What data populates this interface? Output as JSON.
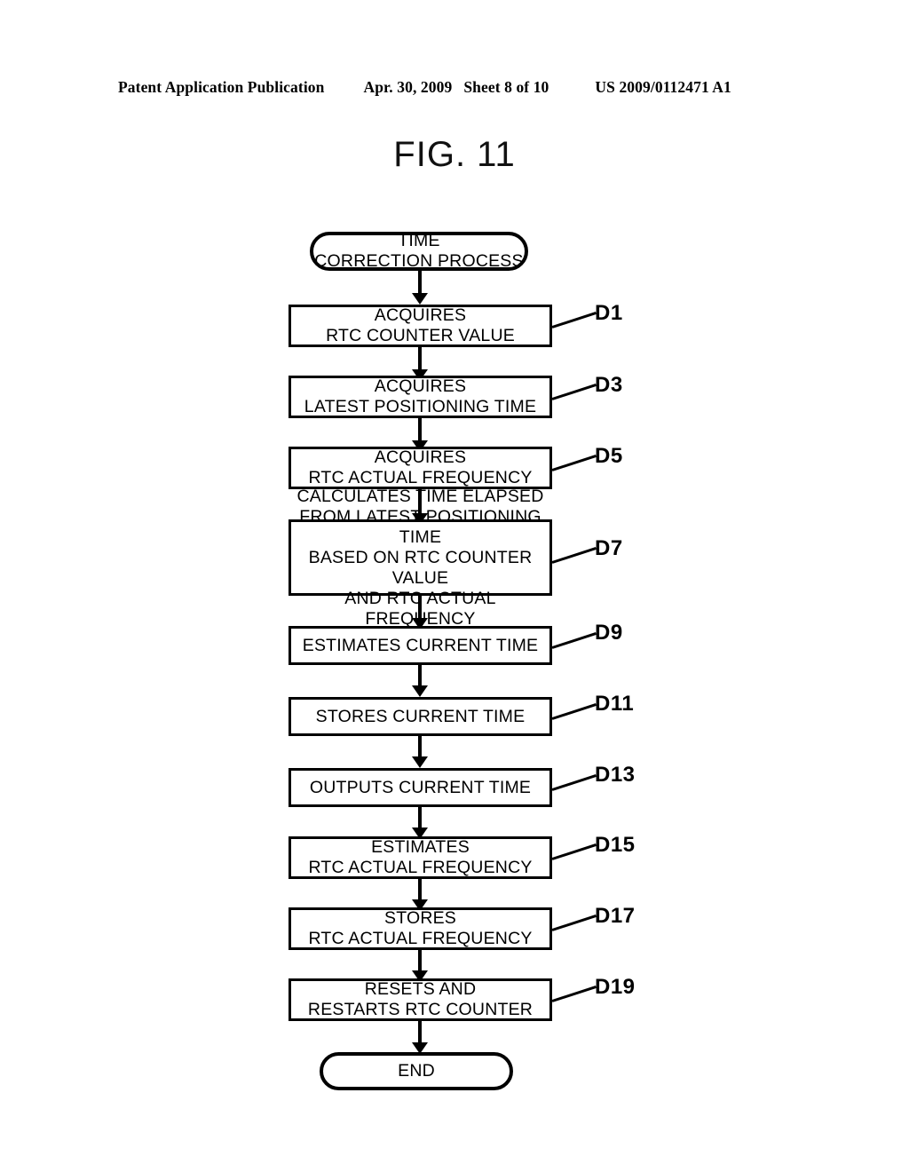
{
  "page_header": {
    "publication": "Patent Application Publication",
    "date": "Apr. 30, 2009",
    "sheet": "Sheet 8 of 10",
    "patent_number": "US 2009/0112471 A1"
  },
  "figure": {
    "title": "FIG. 11"
  },
  "flowchart": {
    "start_node": {
      "label": "TIME\nCORRECTION PROCESS",
      "shape": "stadium"
    },
    "end_node": {
      "label": "END",
      "shape": "stadium"
    },
    "steps": [
      {
        "ref": "D1",
        "label": "ACQUIRES\nRTC COUNTER VALUE"
      },
      {
        "ref": "D3",
        "label": "ACQUIRES\nLATEST POSITIONING TIME"
      },
      {
        "ref": "D5",
        "label": "ACQUIRES\nRTC ACTUAL FREQUENCY"
      },
      {
        "ref": "D7",
        "label": "CALCULATES TIME ELAPSED\nFROM LATEST POSITIONING TIME\nBASED ON RTC COUNTER VALUE\nAND RTC ACTUAL FREQUENCY"
      },
      {
        "ref": "D9",
        "label": "ESTIMATES CURRENT TIME"
      },
      {
        "ref": "D11",
        "label": "STORES CURRENT TIME"
      },
      {
        "ref": "D13",
        "label": "OUTPUTS CURRENT TIME"
      },
      {
        "ref": "D15",
        "label": "ESTIMATES\nRTC ACTUAL FREQUENCY"
      },
      {
        "ref": "D17",
        "label": "STORES\nRTC ACTUAL FREQUENCY"
      },
      {
        "ref": "D19",
        "label": "RESETS AND\nRESTARTS RTC COUNTER"
      }
    ]
  },
  "colors": {
    "ink": "#000000",
    "paper": "#ffffff"
  }
}
